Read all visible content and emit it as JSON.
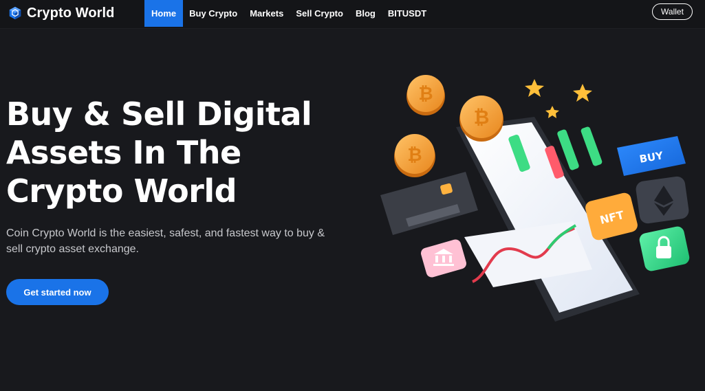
{
  "brand": {
    "name": "Crypto World",
    "icon": "cube-logo-icon",
    "accent": "#1a73e8"
  },
  "nav": {
    "items": [
      {
        "label": "Home",
        "active": true
      },
      {
        "label": "Buy Crypto",
        "active": false
      },
      {
        "label": "Markets",
        "active": false
      },
      {
        "label": "Sell Crypto",
        "active": false
      },
      {
        "label": "Blog",
        "active": false
      },
      {
        "label": "BITUSDT",
        "active": false
      }
    ],
    "wallet_label": "Wallet"
  },
  "hero": {
    "title_lines": [
      "Buy & Sell Digital",
      "Assets In The",
      "Crypto World"
    ],
    "subtitle": "Coin Crypto World is the easiest, safest, and fastest way to buy & sell crypto asset exchange.",
    "cta_label": "Get started now"
  },
  "illustration": {
    "buy_tile_label": "BUY",
    "nft_tile_label": "NFT",
    "coin_symbol": "₿",
    "icons": [
      "bitcoin-coin-icon",
      "credit-card-icon",
      "ethereum-icon",
      "lock-icon",
      "bank-icon",
      "star-icon",
      "candlestick-chart-icon",
      "smartphone-icon"
    ]
  }
}
